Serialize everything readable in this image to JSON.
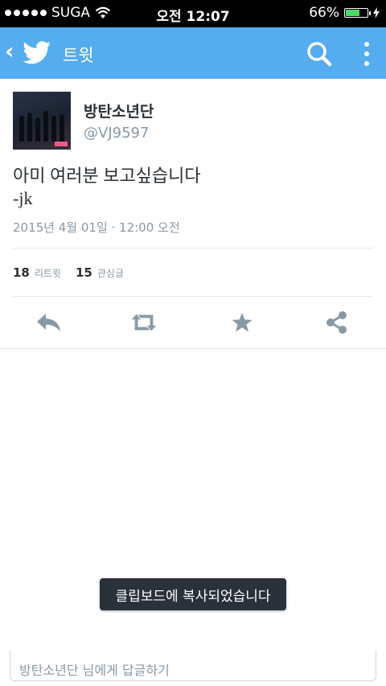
{
  "status_bar": {
    "carrier": "SUGA",
    "time": "오전 12:07",
    "battery_percent": "66%",
    "battery_level": 0.66,
    "icons": [
      "signal-dots-icon",
      "wifi-icon",
      "battery-icon",
      "charging-bolt-icon"
    ]
  },
  "nav": {
    "back_icon": "chevron-left-icon",
    "logo_icon": "twitter-bird-icon",
    "title": "트윗",
    "search_icon": "search-icon",
    "more_icon": "more-vertical-icon"
  },
  "tweet": {
    "user_name": "방탄소년단",
    "user_handle": "@VJ9597",
    "text_lines": [
      "아미 여러분 보고싶습니다",
      "-jk"
    ],
    "timestamp": "2015년 4월 01일 · 12:00 오전",
    "retweet_count": "18",
    "retweet_label": "리트윗",
    "favorite_count": "15",
    "favorite_label": "관심글"
  },
  "actions": {
    "reply_icon": "reply-icon",
    "retweet_icon": "retweet-icon",
    "favorite_icon": "star-icon",
    "share_icon": "share-icon"
  },
  "toast": {
    "message": "클립보드에 복사되었습니다"
  },
  "reply_bar": {
    "placeholder": "방탄소년단 님에게 답글하기"
  },
  "colors": {
    "nav_background": "#55acee",
    "action_icon": "#8899a6",
    "secondary_text": "#8899a6",
    "toast_background": "#2a313a"
  }
}
